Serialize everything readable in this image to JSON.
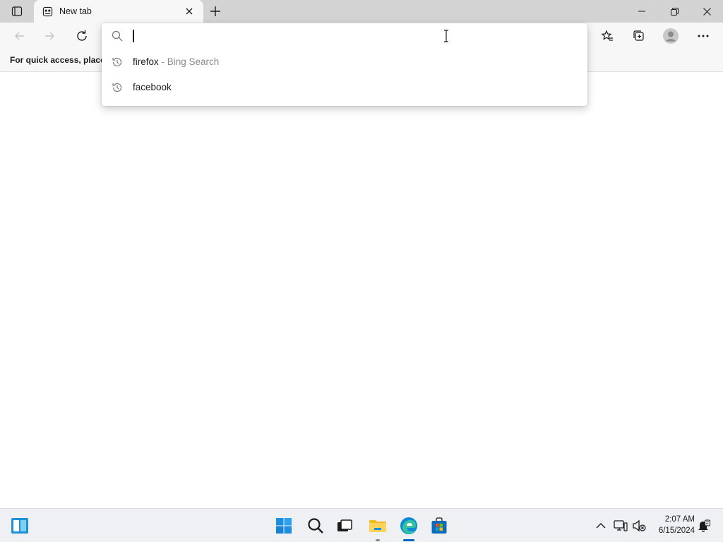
{
  "tab": {
    "title": "New tab",
    "favicon": "new-tab-page-icon"
  },
  "toolbar": {
    "icons": [
      "back-icon",
      "forward-icon",
      "refresh-icon",
      "favorites-icon",
      "collections-icon",
      "profile-icon",
      "more-icon"
    ]
  },
  "favorites_bar": {
    "text": "For quick access, place y"
  },
  "address_bar": {
    "value": "",
    "placeholder": ""
  },
  "suggestions": [
    {
      "text": "firefox",
      "separator": " - ",
      "provider": "Bing Search",
      "icon": "history-icon"
    },
    {
      "text": "facebook",
      "separator": "",
      "provider": "",
      "icon": "history-icon"
    }
  ],
  "taskbar": {
    "apps": [
      "widgets-icon",
      "start-icon",
      "search-icon",
      "task-view-icon",
      "file-explorer-icon",
      "edge-icon",
      "store-icon"
    ],
    "tray": [
      "show-hidden-icons-icon",
      "network-icon",
      "volume-muted-icon",
      "notification-icon"
    ],
    "time": "2:07 AM",
    "date": "6/15/2024"
  },
  "colors": {
    "accent": "#0067c0",
    "tabstrip": "#d3d3d3",
    "toolbar": "#f7f7f7",
    "taskbar": "#eef0f3"
  }
}
